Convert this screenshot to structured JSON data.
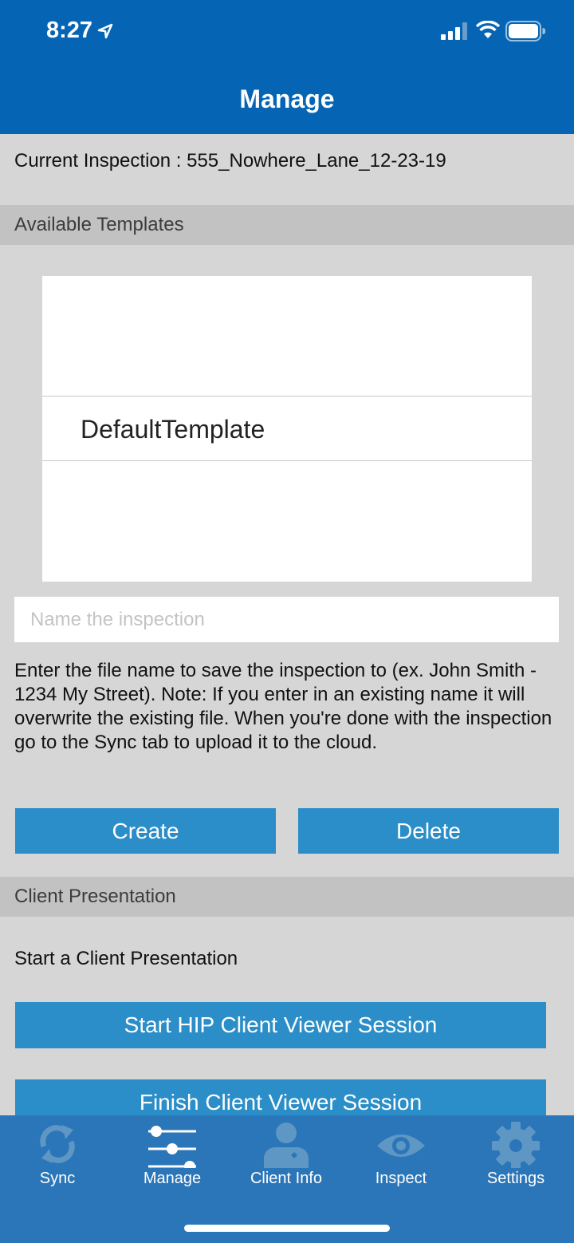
{
  "status_bar": {
    "time": "8:27"
  },
  "nav": {
    "title": "Manage"
  },
  "current_inspection": {
    "text": "Current Inspection : 555_Nowhere_Lane_12-23-19"
  },
  "templates_section": {
    "header": "Available Templates",
    "items": [
      "DefaultTemplate"
    ]
  },
  "name_input": {
    "value": "",
    "placeholder": "Name the inspection"
  },
  "help_text": "Enter the file name to save the inspection to (ex. John Smith - 1234 My Street). Note: If you enter in an existing name it will overwrite the existing file. When you're done with the inspection go to the Sync tab to upload it to the cloud.",
  "buttons": {
    "create": "Create",
    "delete": "Delete"
  },
  "client_section": {
    "header": "Client Presentation",
    "label": "Start a Client Presentation",
    "start_button": "Start HIP Client Viewer Session",
    "finish_button": "Finish Client Viewer Session"
  },
  "tabs": [
    {
      "label": "Sync",
      "icon": "sync-icon"
    },
    {
      "label": "Manage",
      "icon": "sliders-icon"
    },
    {
      "label": "Client Info",
      "icon": "person-icon"
    },
    {
      "label": "Inspect",
      "icon": "eye-icon"
    },
    {
      "label": "Settings",
      "icon": "gear-icon"
    }
  ],
  "colors": {
    "nav_bar": "#0565b4",
    "button": "#2b8ec8",
    "tab_bar": "#2b76b8",
    "section_header": "#c2c2c2",
    "background": "#d6d6d6",
    "tab_icon_inactive": "#5e96c4",
    "tab_icon_active": "#ffffff"
  }
}
